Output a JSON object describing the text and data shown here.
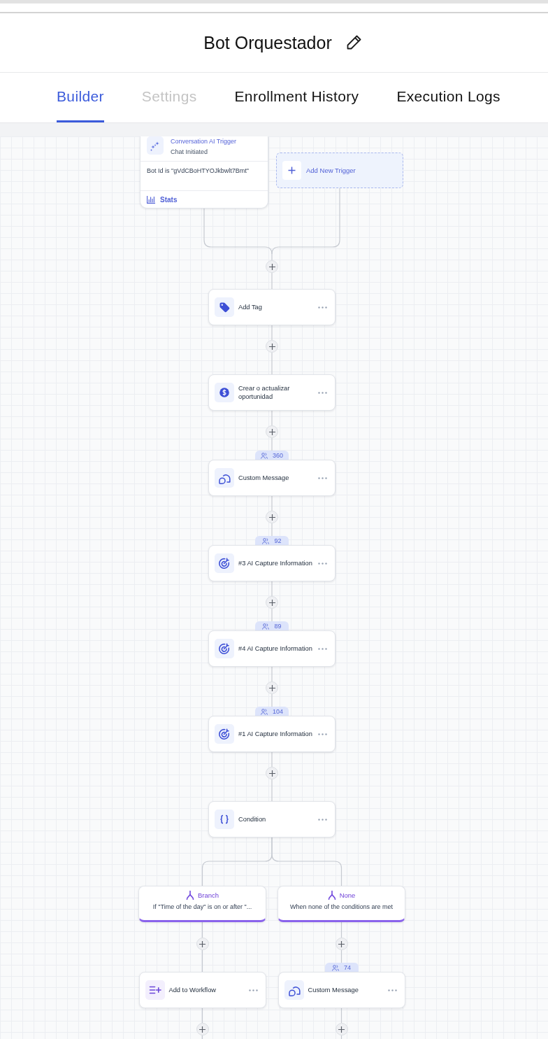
{
  "header": {
    "title": "Bot Orquestador"
  },
  "tabs": [
    {
      "label": "Builder",
      "selected": true,
      "disabled": false
    },
    {
      "label": "Settings",
      "selected": false,
      "disabled": true
    },
    {
      "label": "Enrollment History",
      "selected": false,
      "disabled": false
    },
    {
      "label": "Execution Logs",
      "selected": false,
      "disabled": false
    }
  ],
  "canvas": {
    "trigger": {
      "title": "Conversation AI Trigger",
      "event": "Chat Initiated",
      "filter": "Bot Id is \"gVdCBoHTYOJkbwlt7Bmt\"",
      "stats_label": "Stats"
    },
    "add_trigger": {
      "label": "Add New Trigger"
    },
    "steps": [
      {
        "kind": "tag",
        "title": "Add Tag"
      },
      {
        "kind": "opportunity",
        "title": "Crear o actualizar oportunidad"
      },
      {
        "kind": "message",
        "title": "Custom Message",
        "count": "360"
      },
      {
        "kind": "capture",
        "title": "#3 AI Capture Information",
        "count": "92"
      },
      {
        "kind": "capture",
        "title": "#4 AI Capture Information",
        "count": "89"
      },
      {
        "kind": "capture",
        "title": "#1 AI Capture Information",
        "count": "104"
      },
      {
        "kind": "condition",
        "title": "Condition"
      }
    ],
    "branches": [
      {
        "name": "Branch",
        "condition": "If \"Time of the day\" is on or after \"...",
        "steps": [
          {
            "kind": "workflow",
            "title": "Add to Workflow"
          }
        ]
      },
      {
        "name": "None",
        "condition": "When none of the conditions are met",
        "steps": [
          {
            "kind": "message",
            "title": "Custom Message",
            "count": "74"
          }
        ]
      }
    ]
  }
}
